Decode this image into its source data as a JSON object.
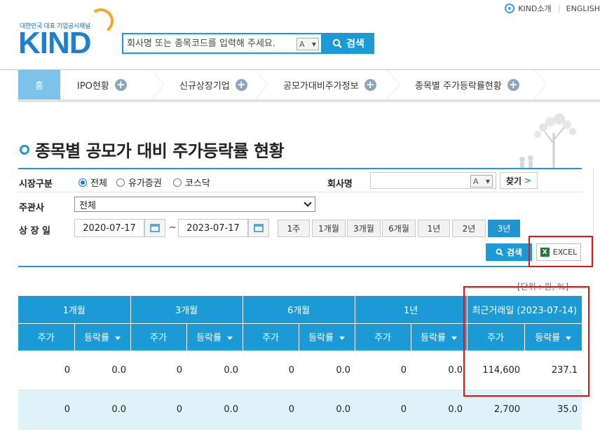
{
  "header": {
    "util_links": [
      "KIND소개",
      "ENGLISH"
    ],
    "logo_sub": "대한민국 대표 기업공시채널",
    "logo_main": "KIND",
    "search_placeholder": "회사명 또는 종목코드를 입력해 주세요.",
    "keyboard_label": "A",
    "search_button": "검색"
  },
  "nav": {
    "home": "홈",
    "items": [
      "IPO현황",
      "신규상장기업",
      "공모가대비주가정보",
      "종목별 주가등락률현황"
    ]
  },
  "page_title": "종목별 공모가 대비 주가등락률 현황",
  "form": {
    "market_label": "시장구분",
    "market_options": [
      "전체",
      "유가증권",
      "코스닥"
    ],
    "market_selected": "전체",
    "company_label": "회사명",
    "company_value": "",
    "company_kb": "A",
    "find_button": "찾기",
    "find_arrow": ">",
    "manager_label": "주관사",
    "manager_value": "전체",
    "date_label": "상 장 일",
    "date_from": "2020-07-17",
    "date_sep": "~",
    "date_to": "2023-07-17",
    "period_buttons": [
      "1주",
      "1개월",
      "3개월",
      "6개월",
      "1년",
      "2년",
      "3년"
    ],
    "period_active": "3년",
    "search_button": "검색",
    "excel_button": "EXCEL",
    "unit": "[단위 : 원, %]"
  },
  "table": {
    "groups": [
      "1개월",
      "3개월",
      "6개월",
      "1년",
      "최근거래일 (2023-07-14)"
    ],
    "sub_price": "주가",
    "sub_rate": "등락률",
    "rows": [
      [
        "0",
        "0.0",
        "0",
        "0.0",
        "0",
        "0.0",
        "0",
        "0.0",
        "114,600",
        "237.1"
      ],
      [
        "0",
        "0.0",
        "0",
        "0.0",
        "0",
        "0.0",
        "0",
        "0.0",
        "2,700",
        "35.0"
      ]
    ]
  },
  "colors": {
    "accent": "#1c9ad6",
    "highlight": "#ee1111",
    "row_alt": "#dff1f9"
  }
}
